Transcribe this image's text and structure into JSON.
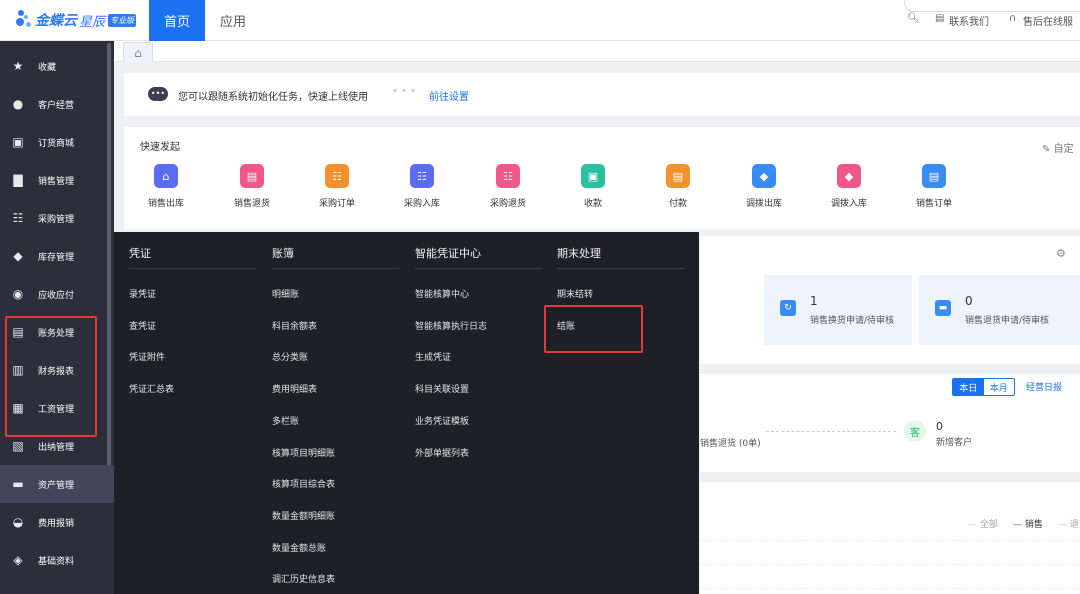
{
  "brand": {
    "name": "金蝶云",
    "product": "星辰",
    "edition": "专业版"
  },
  "top_nav": {
    "tabs": [
      "首页",
      "应用"
    ],
    "contact_label": "联系我们",
    "support_label": "售后在线服"
  },
  "sidebar": {
    "items": [
      {
        "label": "收藏",
        "icon": "star-icon"
      },
      {
        "label": "客户经营",
        "icon": "user-icon"
      },
      {
        "label": "订货商城",
        "icon": "shop-icon"
      },
      {
        "label": "销售管理",
        "icon": "bar-chart-icon"
      },
      {
        "label": "采购管理",
        "icon": "cart-icon"
      },
      {
        "label": "库存管理",
        "icon": "box-icon"
      },
      {
        "label": "应收应付",
        "icon": "coin-icon"
      },
      {
        "label": "账务处理",
        "icon": "ledger-icon"
      },
      {
        "label": "财务报表",
        "icon": "report-icon"
      },
      {
        "label": "工资管理",
        "icon": "wallet-icon"
      },
      {
        "label": "出纳管理",
        "icon": "cashier-icon"
      },
      {
        "label": "资产管理",
        "icon": "asset-icon"
      },
      {
        "label": "费用报销",
        "icon": "expense-icon"
      },
      {
        "label": "基础资料",
        "icon": "layers-icon"
      }
    ]
  },
  "notice": {
    "text": "您可以跟随系统初始化任务，快速上线使用",
    "link": "前往设置"
  },
  "quick_launch": {
    "title": "快速发起",
    "custom_label": "自定",
    "items": [
      {
        "label": "销售出库",
        "color": "#5b6cf0"
      },
      {
        "label": "销售退货",
        "color": "#f2578a"
      },
      {
        "label": "采购订单",
        "color": "#f6902c"
      },
      {
        "label": "采购入库",
        "color": "#5b6cf0"
      },
      {
        "label": "采购退货",
        "color": "#f2578a"
      },
      {
        "label": "收款",
        "color": "#2cbfa4"
      },
      {
        "label": "付款",
        "color": "#f6902c"
      },
      {
        "label": "调拨出库",
        "color": "#3a8cf5"
      },
      {
        "label": "调拨入库",
        "color": "#f2578a"
      },
      {
        "label": "销售订单",
        "color": "#3a8cf5"
      }
    ]
  },
  "pending": {
    "cards": [
      {
        "count": "1",
        "label": "销售换货申请/待审核",
        "color": "#3a8cf5"
      },
      {
        "count": "0",
        "label": "销售退货申请/待审核",
        "color": "#3a8cf5"
      }
    ]
  },
  "summary": {
    "today": "本日",
    "month": "本月",
    "report_link": "经营日报",
    "return_label": "销售退货 (0单)",
    "new_customers_count": "0",
    "new_customers_label": "新增客户",
    "customer_icon_text": "客"
  },
  "sales_chart": {
    "legend": [
      "全部",
      "销售",
      "退"
    ]
  },
  "mega_menu": {
    "columns": [
      {
        "title": "凭证",
        "items": [
          "录凭证",
          "查凭证",
          "凭证附件",
          "凭证汇总表"
        ]
      },
      {
        "title": "账簿",
        "items": [
          "明细账",
          "科目余额表",
          "总分类账",
          "费用明细表",
          "多栏账",
          "核算项目明细账",
          "核算项目综合表",
          "数量金额明细账",
          "数量金额总账",
          "调汇历史信息表"
        ]
      },
      {
        "title": "智能凭证中心",
        "items": [
          "智能核算中心",
          "智能核算执行日志",
          "生成凭证",
          "科目关联设置",
          "业务凭证模板",
          "外部单据列表"
        ]
      },
      {
        "title": "期末处理",
        "items": [
          "期末结转",
          "结账"
        ]
      }
    ]
  },
  "colors": {
    "accent": "#1a72f0",
    "sidebar_bg": "#2c2f3b",
    "menu_bg": "#1e1f27",
    "highlight": "#e53935"
  }
}
